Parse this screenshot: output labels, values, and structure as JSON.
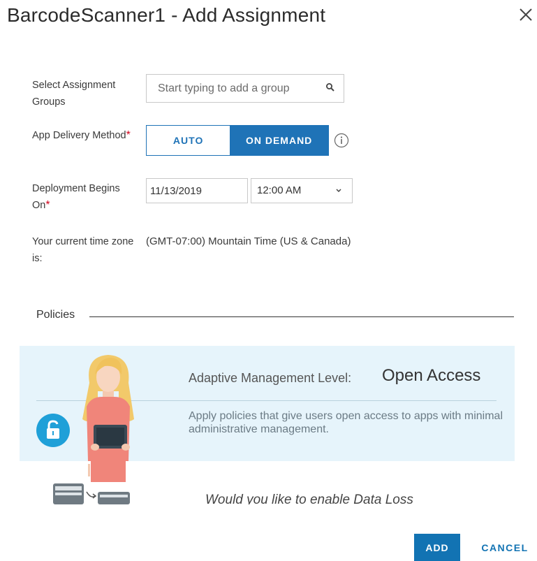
{
  "dialog": {
    "title": "BarcodeScanner1 - Add Assignment"
  },
  "form": {
    "groups_label": "Select Assignment Groups",
    "groups_placeholder": "Start typing to add a group",
    "delivery_label": "App Delivery Method",
    "delivery_options": [
      "AUTO",
      "ON DEMAND"
    ],
    "delivery_selected": "ON DEMAND",
    "deployment_label": "Deployment Begins On",
    "deployment_date": "11/13/2019",
    "deployment_time": "12:00 AM",
    "timezone_label": "Your current time zone is:",
    "timezone_value": "(GMT-07:00) Mountain Time (US & Canada)",
    "required_mark": "*"
  },
  "policies": {
    "section_label": "Policies",
    "aml_label": "Adaptive Management Level:",
    "aml_value": "Open Access",
    "aml_description": "Apply policies that give users open access to apps with minimal administrative management.",
    "dlp_prompt": "Would you like to enable Data Loss"
  },
  "footer": {
    "add_label": "ADD",
    "cancel_label": "CANCEL"
  },
  "colors": {
    "primary": "#1f73b7",
    "required": "#d0021b",
    "banner_bg": "#e6f4fb",
    "lock_badge": "#1fa0d8"
  },
  "icons": [
    "close-icon",
    "search-icon",
    "info-icon",
    "chevron-down-icon",
    "unlock-icon",
    "person-illustration",
    "device-transfer-icon"
  ]
}
